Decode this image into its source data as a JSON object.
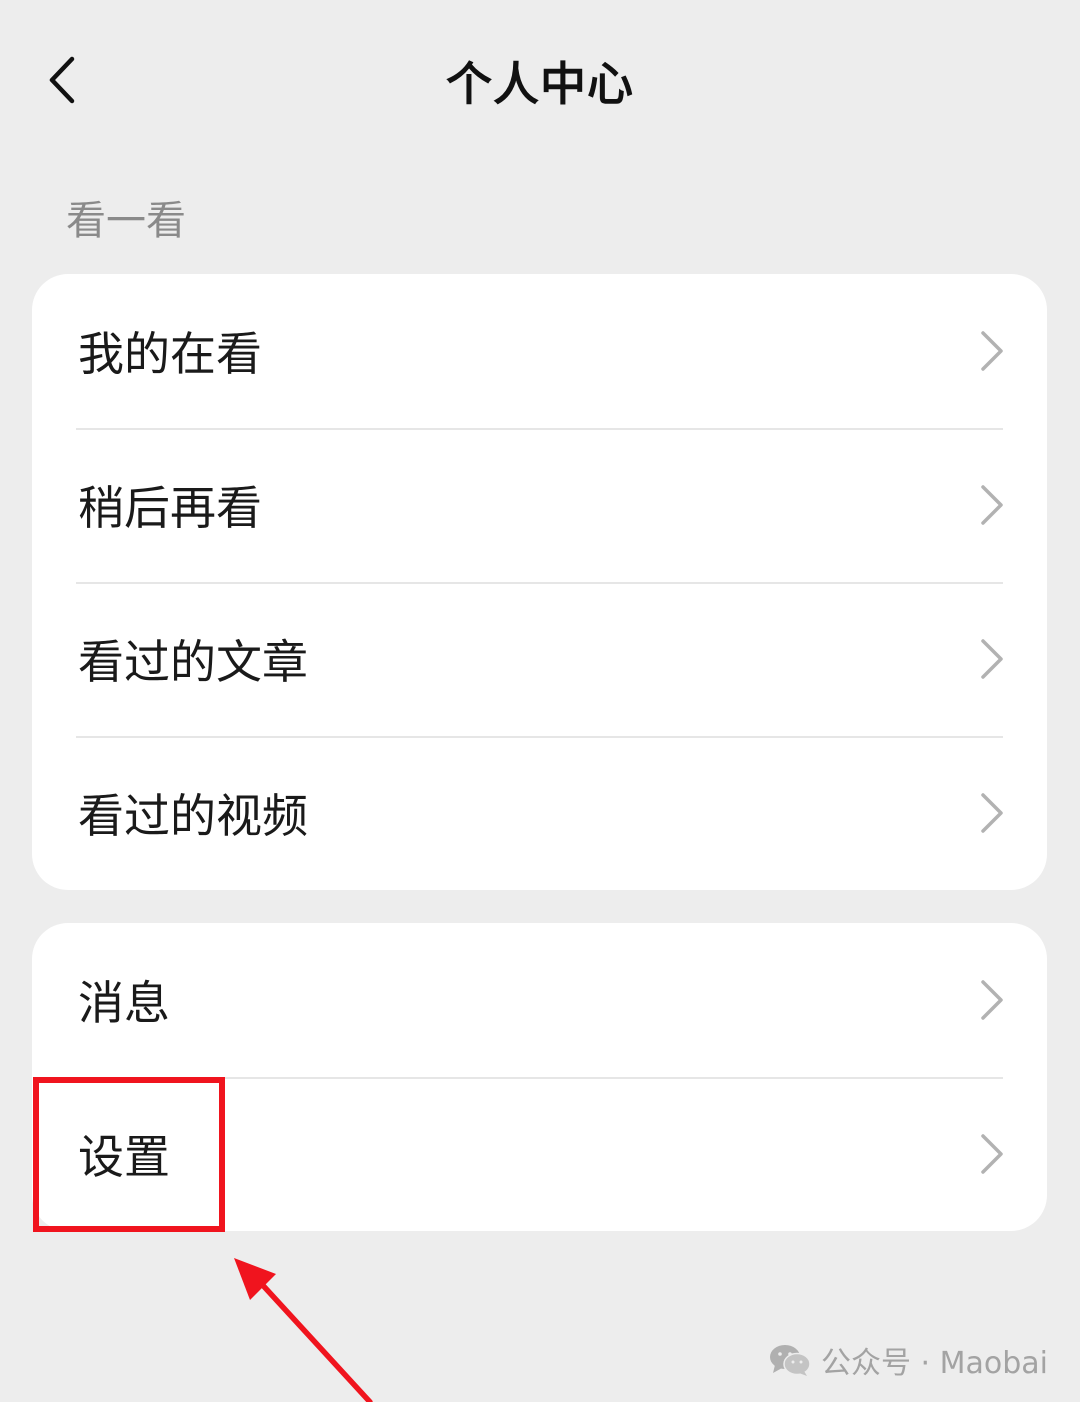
{
  "header": {
    "title": "个人中心",
    "back_icon": "chevron-left-icon"
  },
  "section": {
    "label": "看一看"
  },
  "group1": {
    "items": [
      {
        "label": "我的在看"
      },
      {
        "label": "稍后再看"
      },
      {
        "label": "看过的文章"
      },
      {
        "label": "看过的视频"
      }
    ]
  },
  "group2": {
    "items": [
      {
        "label": "消息"
      },
      {
        "label": "设置"
      }
    ]
  },
  "annotation": {
    "highlight_color": "#f0141e",
    "highlighted_item": "设置"
  },
  "watermark": {
    "text": "公众号 · Maobai",
    "icon": "wechat-icon"
  },
  "colors": {
    "background": "#ededed",
    "card": "#ffffff",
    "chevron": "#b2b2b2"
  }
}
